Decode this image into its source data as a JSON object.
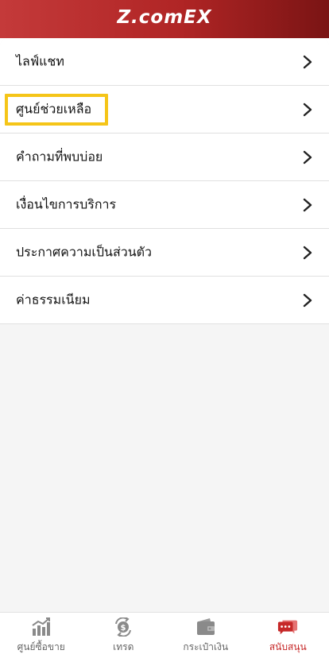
{
  "header": {
    "logo_text": "Z.comEX"
  },
  "menu": {
    "items": [
      {
        "label": "ไลฟ์แชท"
      },
      {
        "label": "ศูนย์ช่วยเหลือ"
      },
      {
        "label": "คำถามที่พบบ่อย"
      },
      {
        "label": "เงื่อนไขการบริการ"
      },
      {
        "label": "ประกาศความเป็นส่วนตัว"
      },
      {
        "label": "ค่าธรรมเนียม"
      }
    ],
    "highlighted_item": "ศูนย์ช่วยเหลือ"
  },
  "tabbar": {
    "tabs": [
      {
        "label": "ศูนย์ซื้อขาย",
        "icon": "bar-chart-icon"
      },
      {
        "label": "เทรด",
        "icon": "exchange-dollar-icon"
      },
      {
        "label": "กระเป๋าเงิน",
        "icon": "wallet-icon"
      },
      {
        "label": "สนับสนุน",
        "icon": "chat-bubbles-icon"
      }
    ],
    "active": "สนับสนุน"
  },
  "colors": {
    "header_start": "#c43a3a",
    "header_end": "#7a1414",
    "highlight_border": "#f5c518",
    "active_tab": "#c62828",
    "inactive_tab": "#666666"
  }
}
